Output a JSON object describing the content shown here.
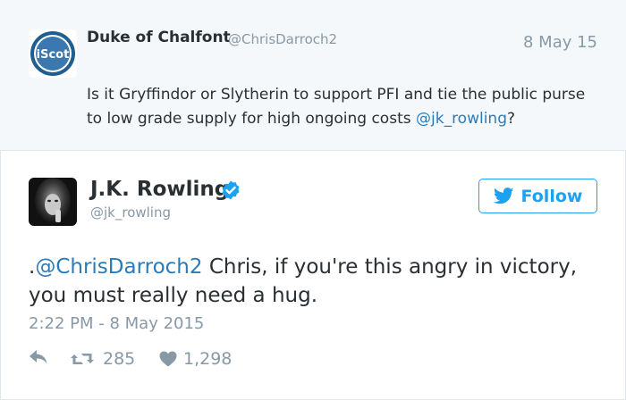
{
  "parent_tweet": {
    "display_name": "Duke of Chalfont",
    "handle": "@ChrisDarroch2",
    "date": "8 May 15",
    "avatar_text": "iScot",
    "text_before": "Is it Gryffindor or Slytherin to support PFI and tie the public purse to low grade supply for high ongoing costs ",
    "mention": "@jk_rowling",
    "text_after": "?"
  },
  "main_tweet": {
    "display_name": "J.K. Rowling",
    "handle": "@jk_rowling",
    "follow_label": "Follow",
    "text_prefix": ".",
    "mention": "@ChrisDarroch2",
    "text_body": " Chris, if you're this angry in victory, you must really need a hug.",
    "timestamp": "2:22 PM - 8 May 2015",
    "retweets": "285",
    "likes": "1,298"
  },
  "icons": {
    "reply": "reply-icon",
    "retweet": "retweet-icon",
    "like": "heart-icon",
    "verified": "verified-badge-icon",
    "follow": "bird-icon"
  },
  "colors": {
    "link": "#2b7bb9",
    "brand": "#1da1f2",
    "muted": "#8899a6",
    "parent_bg": "#f5f8fa"
  }
}
